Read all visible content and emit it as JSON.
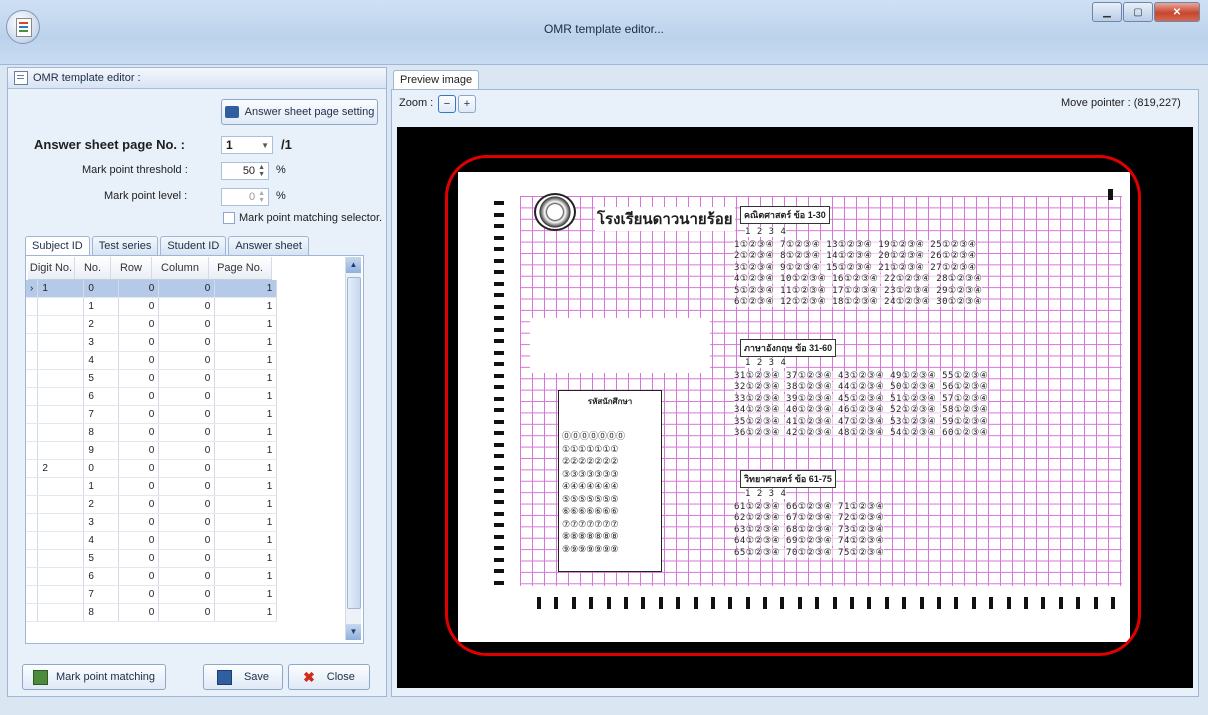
{
  "window": {
    "title": "OMR template editor..."
  },
  "left_panel": {
    "header": "OMR template editor :",
    "answer_sheet_setting_button": "Answer sheet page setting",
    "page_no_label": "Answer sheet page No. :",
    "page_no_value": "1",
    "page_total": "/1",
    "threshold_label": "Mark point threshold :",
    "threshold_value": "50",
    "threshold_unit": "%",
    "level_label": "Mark point level :",
    "level_value": "0",
    "level_unit": "%",
    "matching_selector_label": "Mark point matching selector."
  },
  "tabs": [
    "Subject ID",
    "Test series",
    "Student ID",
    "Answer sheet"
  ],
  "grid": {
    "columns": [
      "Digit No.",
      "No.",
      "Row",
      "Column",
      "Page No."
    ],
    "rows": [
      {
        "digit": "1",
        "no": "0",
        "row": "0",
        "col": "0",
        "page": "1"
      },
      {
        "digit": "",
        "no": "1",
        "row": "0",
        "col": "0",
        "page": "1"
      },
      {
        "digit": "",
        "no": "2",
        "row": "0",
        "col": "0",
        "page": "1"
      },
      {
        "digit": "",
        "no": "3",
        "row": "0",
        "col": "0",
        "page": "1"
      },
      {
        "digit": "",
        "no": "4",
        "row": "0",
        "col": "0",
        "page": "1"
      },
      {
        "digit": "",
        "no": "5",
        "row": "0",
        "col": "0",
        "page": "1"
      },
      {
        "digit": "",
        "no": "6",
        "row": "0",
        "col": "0",
        "page": "1"
      },
      {
        "digit": "",
        "no": "7",
        "row": "0",
        "col": "0",
        "page": "1"
      },
      {
        "digit": "",
        "no": "8",
        "row": "0",
        "col": "0",
        "page": "1"
      },
      {
        "digit": "",
        "no": "9",
        "row": "0",
        "col": "0",
        "page": "1"
      },
      {
        "digit": "2",
        "no": "0",
        "row": "0",
        "col": "0",
        "page": "1"
      },
      {
        "digit": "",
        "no": "1",
        "row": "0",
        "col": "0",
        "page": "1"
      },
      {
        "digit": "",
        "no": "2",
        "row": "0",
        "col": "0",
        "page": "1"
      },
      {
        "digit": "",
        "no": "3",
        "row": "0",
        "col": "0",
        "page": "1"
      },
      {
        "digit": "",
        "no": "4",
        "row": "0",
        "col": "0",
        "page": "1"
      },
      {
        "digit": "",
        "no": "5",
        "row": "0",
        "col": "0",
        "page": "1"
      },
      {
        "digit": "",
        "no": "6",
        "row": "0",
        "col": "0",
        "page": "1"
      },
      {
        "digit": "",
        "no": "7",
        "row": "0",
        "col": "0",
        "page": "1"
      },
      {
        "digit": "",
        "no": "8",
        "row": "0",
        "col": "0",
        "page": "1"
      }
    ]
  },
  "bottom_buttons": {
    "matching": "Mark point matching",
    "save": "Save",
    "close": "Close"
  },
  "preview": {
    "tab": "Preview image",
    "zoom_label": "Zoom :",
    "pointer_label": "Move pointer : (819,227)"
  },
  "sheet": {
    "school_title": "โรงเรียนดาวนายร้อย",
    "section_math": "คณิตศาสตร์ ข้อ 1-30",
    "section_english": "ภาษาอังกฤษ ข้อ 31-60",
    "section_science": "วิทยาศาสตร์ ข้อ 61-75",
    "student_id_caption": "รหัสนักศึกษา",
    "choice_header": "1 2 3 4"
  },
  "colors": {
    "highlight_ring": "#e00000",
    "template_grid": "#cc55cc",
    "selected_row": "#b5c9e8"
  }
}
